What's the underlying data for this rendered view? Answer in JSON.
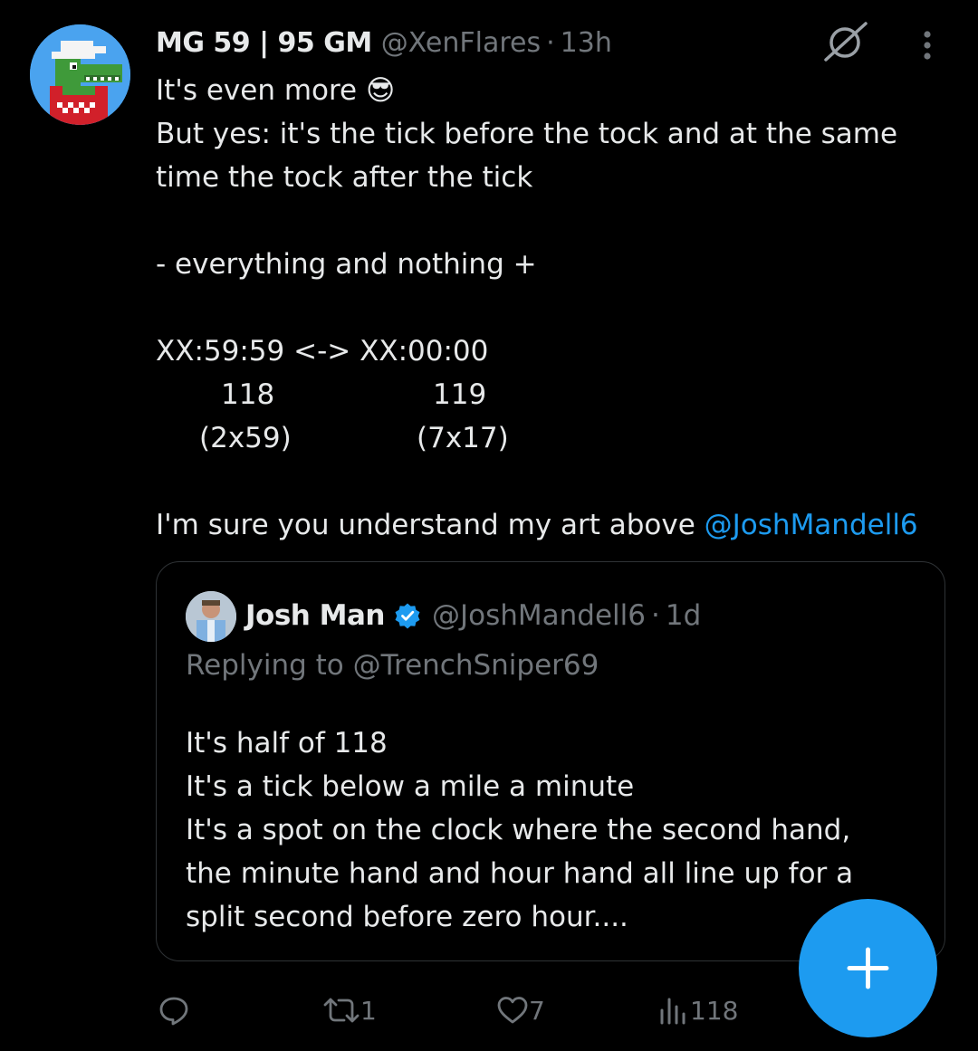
{
  "tweet": {
    "author": {
      "display_name": "MG 59 | 95 GM",
      "handle": "@XenFlares",
      "separator": "·",
      "time": "13h"
    },
    "lines": {
      "l1_text": "It's even more ",
      "l1_emoji": "😎",
      "l2": "But yes: it's the tick before the tock and at the same",
      "l3": "time the tock after the tick",
      "l5": "- everything and nothing +",
      "l7": "XX:59:59 <-> XX:00:00",
      "l8_a": "118",
      "l8_b": "119",
      "l9_a": "(2x59)",
      "l9_b": "(7x17)",
      "l11_text": "I'm sure you understand my art above ",
      "l11_mention": "@JoshMandell6"
    }
  },
  "quote": {
    "display_name": "Josh Man",
    "handle": "@JoshMandell6",
    "separator": "·",
    "time": "1d",
    "replying_to": "Replying to @TrenchSniper69",
    "lines": [
      "It's half of 118",
      "It's a tick below a mile a minute",
      "It's a spot on the clock where the second hand,",
      "the minute hand and hour hand all line up for a",
      "split second before zero hour...."
    ]
  },
  "actions": {
    "reposts": "1",
    "likes": "7",
    "views": "118"
  },
  "icons": {
    "grok": "grok-icon",
    "more": "more-vertical-icon",
    "verified": "verified-badge-icon",
    "reply": "reply-icon",
    "repost": "repost-icon",
    "like": "heart-icon",
    "views": "views-chart-icon",
    "compose": "plus-icon"
  },
  "colors": {
    "background": "#000000",
    "text": "#e7e9ea",
    "secondary": "#71767b",
    "accent": "#1d9bf0",
    "border": "#2f3336"
  }
}
